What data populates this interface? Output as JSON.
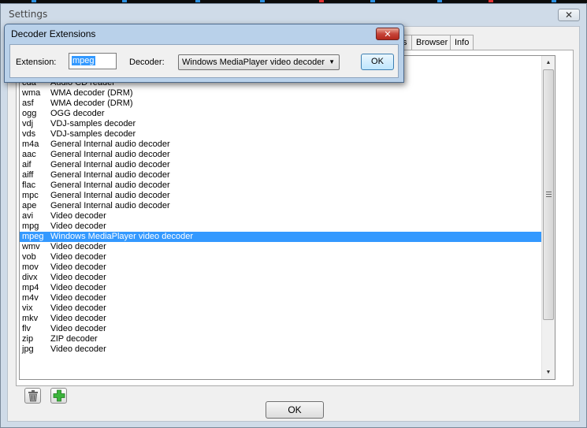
{
  "settings": {
    "title": "Settings",
    "close_glyph": "✕",
    "tabs": [
      {
        "label": "s"
      },
      {
        "label": "Browser"
      },
      {
        "label": "Info"
      }
    ],
    "ok_label": "OK"
  },
  "list": {
    "rows": [
      {
        "ext": "cda",
        "decoder": "Audio CD reader"
      },
      {
        "ext": "wma",
        "decoder": "WMA decoder (DRM)"
      },
      {
        "ext": "asf",
        "decoder": "WMA decoder (DRM)"
      },
      {
        "ext": "ogg",
        "decoder": "OGG decoder"
      },
      {
        "ext": "vdj",
        "decoder": "VDJ-samples decoder"
      },
      {
        "ext": "vds",
        "decoder": "VDJ-samples decoder"
      },
      {
        "ext": "m4a",
        "decoder": "General Internal audio decoder"
      },
      {
        "ext": "aac",
        "decoder": "General Internal audio decoder"
      },
      {
        "ext": "aif",
        "decoder": "General Internal audio decoder"
      },
      {
        "ext": "aiff",
        "decoder": "General Internal audio decoder"
      },
      {
        "ext": "flac",
        "decoder": "General Internal audio decoder"
      },
      {
        "ext": "mpc",
        "decoder": "General Internal audio decoder"
      },
      {
        "ext": "ape",
        "decoder": "General Internal audio decoder"
      },
      {
        "ext": "avi",
        "decoder": "Video decoder"
      },
      {
        "ext": "mpg",
        "decoder": "Video decoder"
      },
      {
        "ext": "mpeg",
        "decoder": "Windows MediaPlayer video decoder"
      },
      {
        "ext": "wmv",
        "decoder": "Video decoder"
      },
      {
        "ext": "vob",
        "decoder": "Video decoder"
      },
      {
        "ext": "mov",
        "decoder": "Video decoder"
      },
      {
        "ext": "divx",
        "decoder": "Video decoder"
      },
      {
        "ext": "mp4",
        "decoder": "Video decoder"
      },
      {
        "ext": "m4v",
        "decoder": "Video decoder"
      },
      {
        "ext": "vix",
        "decoder": "Video decoder"
      },
      {
        "ext": "mkv",
        "decoder": "Video decoder"
      },
      {
        "ext": "flv",
        "decoder": "Video decoder"
      },
      {
        "ext": "zip",
        "decoder": "ZIP decoder"
      },
      {
        "ext": "jpg",
        "decoder": "Video decoder"
      }
    ],
    "selected_ext": "mpeg"
  },
  "icons": {
    "delete": "trash-icon",
    "add": "plus-icon",
    "add_color": "#3cb43c"
  },
  "dialog": {
    "title": "Decoder Extensions",
    "close_glyph": "✕",
    "extension_label": "Extension:",
    "extension_value": "mpeg",
    "decoder_label": "Decoder:",
    "decoder_value": "Windows MediaPlayer video decoder",
    "ok_label": "OK"
  },
  "colors": {
    "selection": "#3399ff"
  }
}
